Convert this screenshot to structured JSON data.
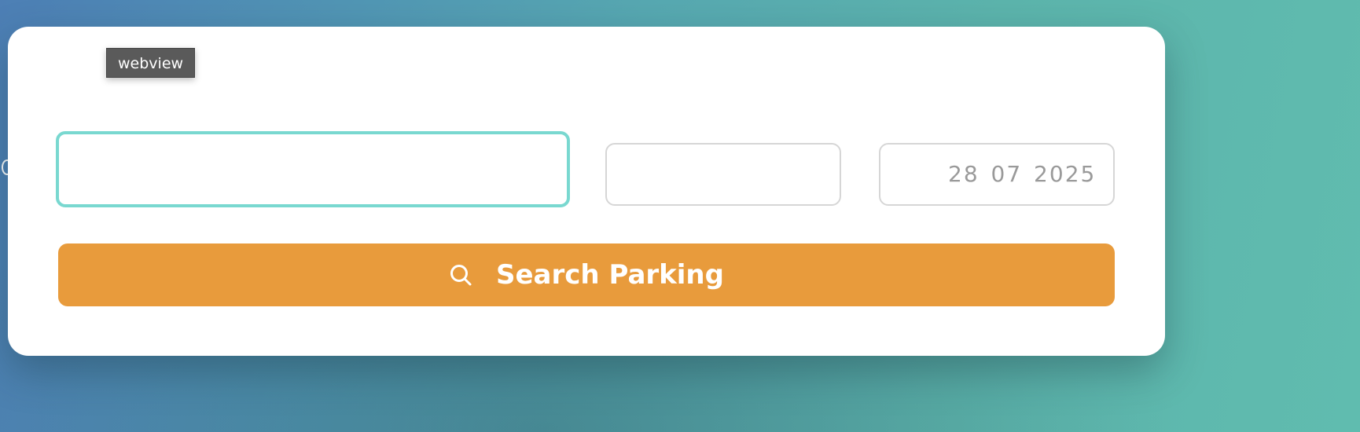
{
  "tooltip": {
    "text": "webview"
  },
  "form": {
    "location": {
      "value": "",
      "placeholder": ""
    },
    "time": {
      "value": ""
    },
    "date": {
      "value": "28 07 2025"
    },
    "search_button": {
      "label": "Search Parking",
      "icon": "search-icon"
    }
  },
  "colors": {
    "accent": "#e89b3c",
    "focus_border": "#79d8d0",
    "field_border": "#d6d6d6",
    "card_background": "#ffffff"
  }
}
